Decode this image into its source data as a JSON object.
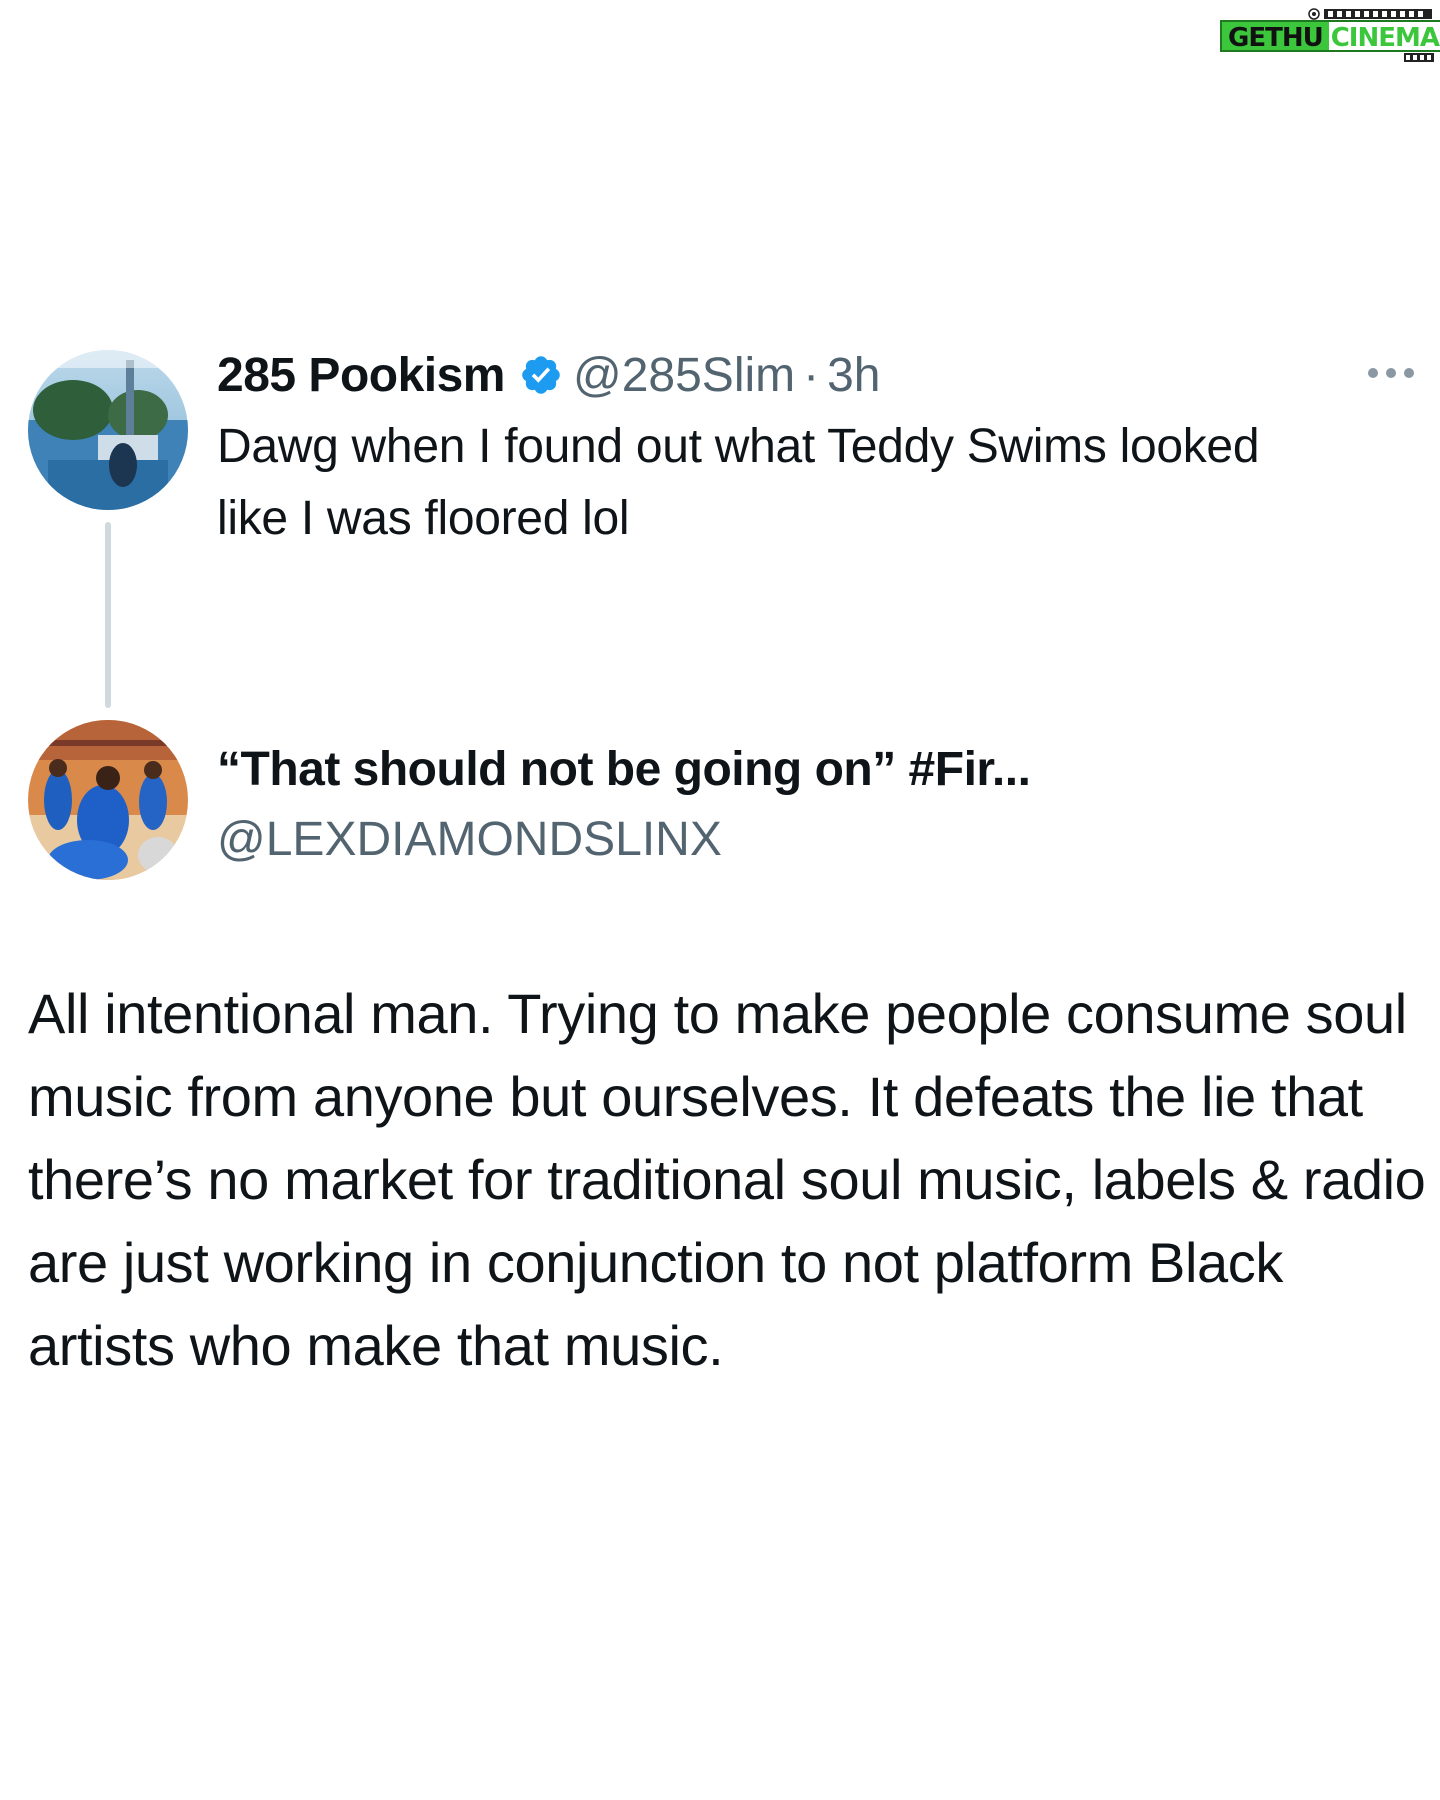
{
  "watermark": {
    "left_text": "GETHU",
    "right_text": "CINEMA",
    "colors": {
      "green": "#3cc63c",
      "dark_green": "#1f7a1f"
    }
  },
  "tweet": {
    "display_name": "285 Pookism",
    "verified": true,
    "handle": "@285Slim",
    "separator": "·",
    "time": "3h",
    "text": "Dawg when I found out what Teddy Swims looked like I was floored lol",
    "more_icon": "more-horizontal-icon"
  },
  "quote": {
    "display_name": "“That should not be going on” #Fir...",
    "handle": "@LEXDIAMONDSLINX"
  },
  "reply_text": "All intentional man. Trying to make people consume soul music from anyone but ourselves. It defeats the lie that there’s no market for traditional soul music, labels & radio are just working in conjunction to not platform Black artists who make that music.",
  "colors": {
    "text": "#0f1419",
    "secondary": "#536471",
    "verified_blue": "#1d9bf0",
    "thread_line": "#cfd9de"
  }
}
